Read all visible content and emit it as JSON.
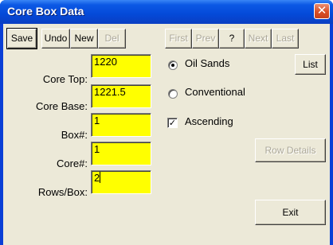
{
  "window": {
    "title": "Core Box Data",
    "close_glyph": "✕"
  },
  "toolbar": {
    "save": "Save",
    "undo": "Undo",
    "new": "New",
    "del": "Del",
    "first": "First",
    "prev": "Prev",
    "help": "?",
    "next": "Next",
    "last": "Last"
  },
  "fields": {
    "core_top": {
      "label": "Core Top:",
      "value": "1220"
    },
    "core_base": {
      "label": "Core Base:",
      "value": "1221.5"
    },
    "box_no": {
      "label": "Box#:",
      "value": "1"
    },
    "core_no": {
      "label": "Core#:",
      "value": "1"
    },
    "rows_per_box": {
      "label": "Rows/Box:",
      "value": "2"
    }
  },
  "options": {
    "oil_sands": {
      "label": "Oil Sands",
      "selected": true
    },
    "conventional": {
      "label": "Conventional",
      "selected": false
    },
    "ascending": {
      "label": "Ascending",
      "checked": true,
      "check_glyph": "✓"
    }
  },
  "actions": {
    "list": "List",
    "row_details": "Row Details",
    "exit": "Exit"
  },
  "colors": {
    "titlebar": "#0449d8",
    "face": "#ece9d8",
    "field": "#ffff00",
    "close": "#d94e25"
  }
}
